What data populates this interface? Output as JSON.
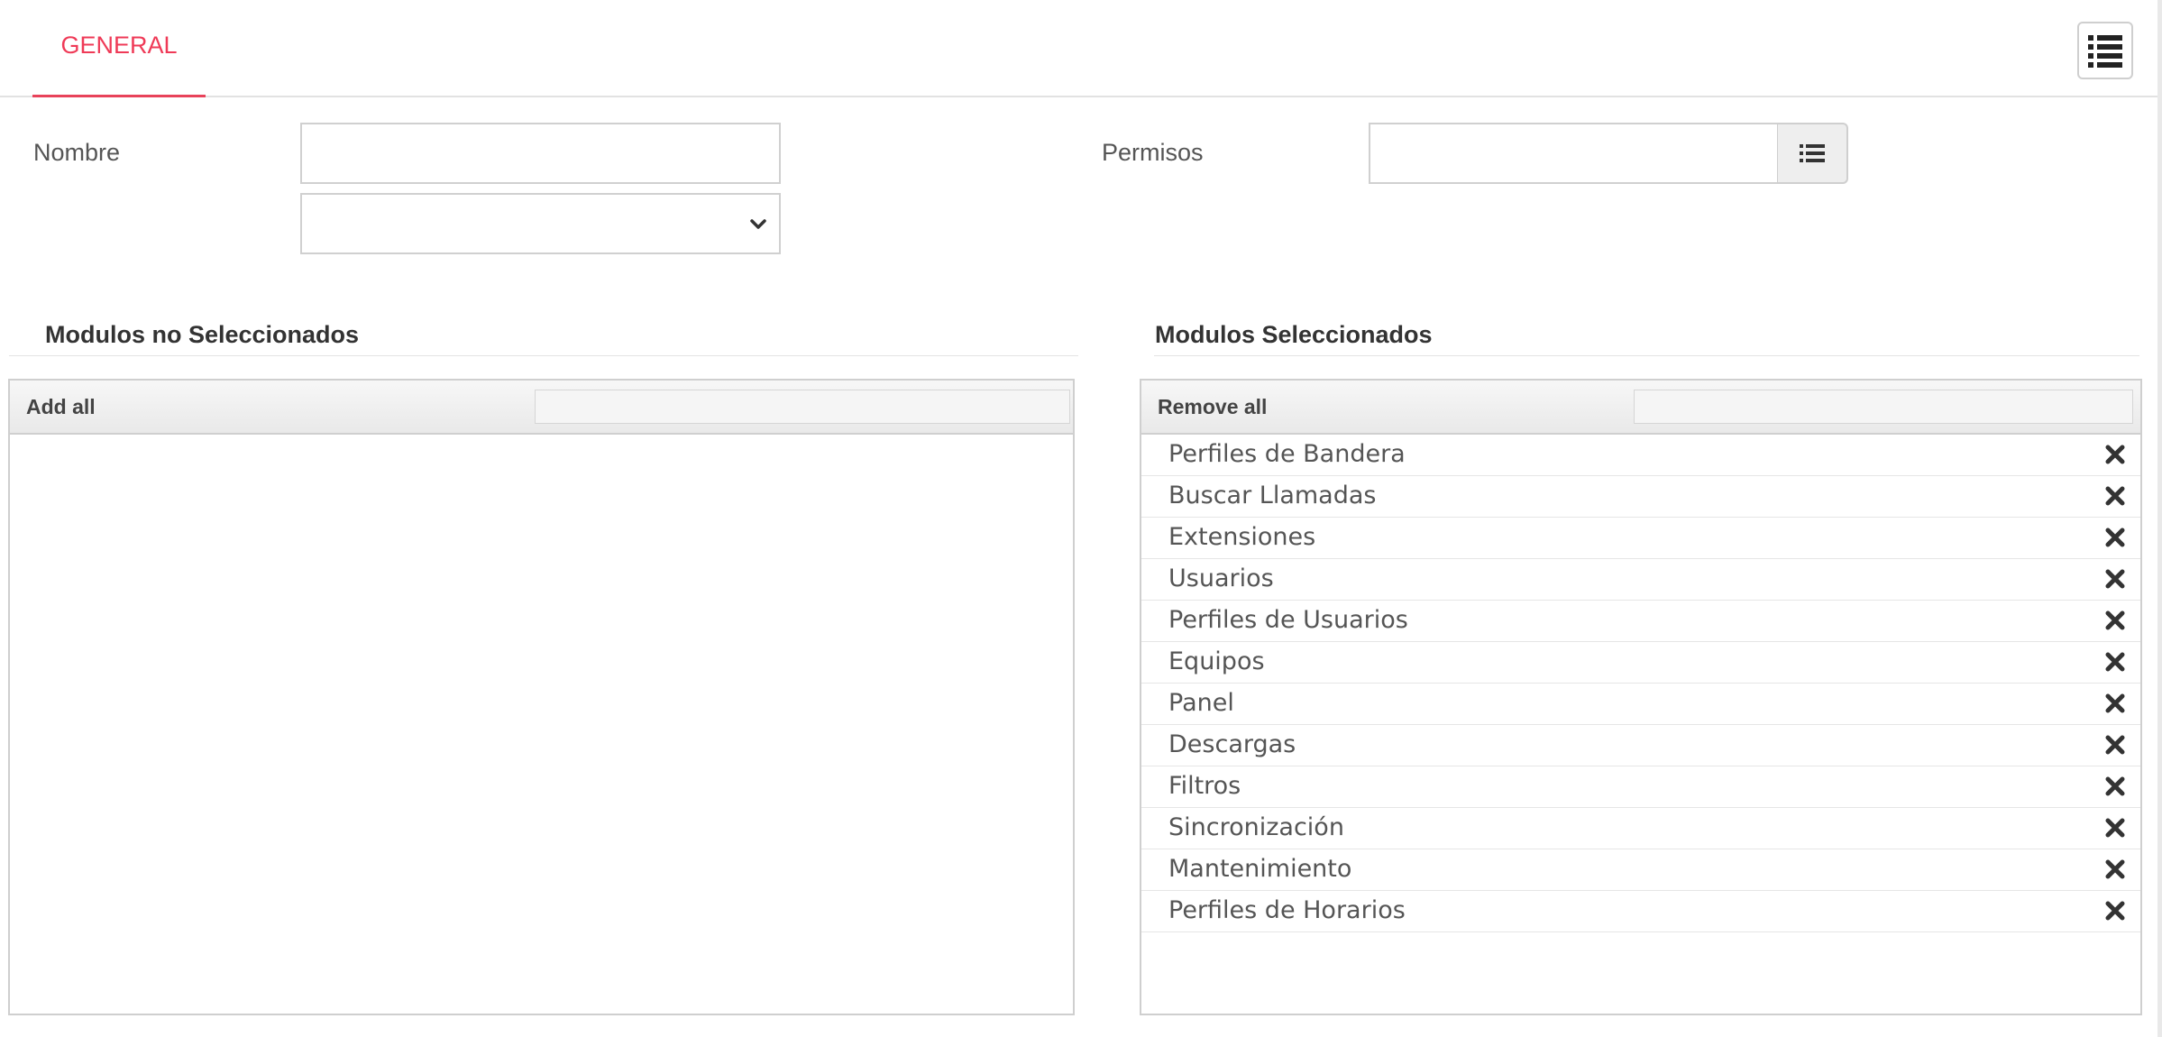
{
  "tabs": [
    {
      "label": "GENERAL",
      "active": true
    }
  ],
  "form": {
    "nombre_label": "Nombre",
    "nombre_value": "",
    "permisos_label": "Permisos",
    "permisos_value": "",
    "select_value": ""
  },
  "left_panel": {
    "title": "Modulos no Seleccionados",
    "action_label": "Add all",
    "filter_value": "",
    "items": []
  },
  "right_panel": {
    "title": "Modulos Seleccionados",
    "action_label": "Remove all",
    "filter_value": "",
    "items": [
      "Perfiles de Bandera",
      "Buscar Llamadas",
      "Extensiones",
      "Usuarios",
      "Perfiles de Usuarios",
      "Equipos",
      "Panel",
      "Descargas",
      "Filtros",
      "Sincronización",
      "Mantenimiento",
      "Perfiles de Horarios"
    ]
  },
  "colors": {
    "accent": "#ef3a57",
    "border": "#cfcfcf",
    "text": "#555555"
  },
  "icons": {
    "menu": "list-icon",
    "permisos_addon": "list-icon",
    "select": "chevron-down-icon",
    "remove_item": "close-icon"
  }
}
